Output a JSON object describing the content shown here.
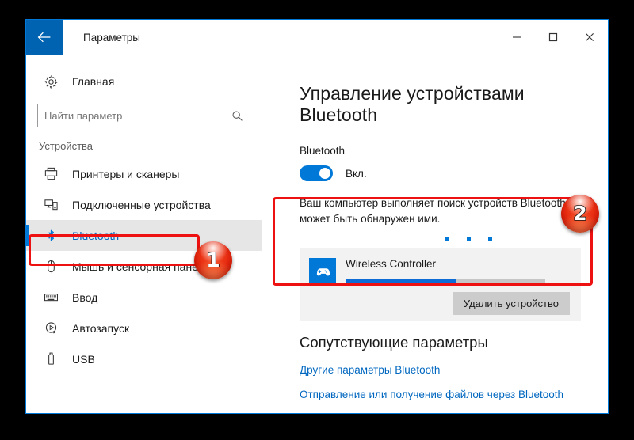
{
  "window": {
    "title": "Параметры",
    "back_icon": "back-arrow-icon",
    "minimize_label": "—",
    "maximize_label": "◻",
    "close_label": "✕"
  },
  "sidebar": {
    "home": {
      "label": "Главная",
      "icon": "gear-icon"
    },
    "search": {
      "placeholder": "Найти параметр",
      "value": "",
      "icon": "search-icon"
    },
    "section_header": "Устройства",
    "items": [
      {
        "label": "Принтеры и сканеры",
        "icon": "printer-icon",
        "selected": false
      },
      {
        "label": "Подключенные устройства",
        "icon": "connected-devices-icon",
        "selected": false
      },
      {
        "label": "Bluetooth",
        "icon": "bluetooth-icon",
        "selected": true
      },
      {
        "label": "Мышь и сенсорная панель",
        "icon": "mouse-icon",
        "selected": false
      },
      {
        "label": "Ввод",
        "icon": "keyboard-icon",
        "selected": false
      },
      {
        "label": "Автозапуск",
        "icon": "autoplay-icon",
        "selected": false
      },
      {
        "label": "USB",
        "icon": "usb-icon",
        "selected": false
      }
    ]
  },
  "main": {
    "page_title": "Управление устройствами Bluetooth",
    "bluetooth_label": "Bluetooth",
    "toggle": {
      "state_label": "Вкл.",
      "on": true
    },
    "status_text": "Ваш компьютер выполняет поиск устройств Bluetooth и может быть обнаружен ими.",
    "searching_dots": 3,
    "device": {
      "name": "Wireless Controller",
      "icon": "gamepad-icon",
      "progress_percent": 55,
      "remove_button": "Удалить устройство"
    },
    "related_title": "Сопутствующие параметры",
    "links": [
      "Другие параметры Bluetooth",
      "Отправление или получение файлов через Bluetooth"
    ]
  },
  "annotations": {
    "badges": [
      {
        "number": "1",
        "target": "sidebar-item-bluetooth"
      },
      {
        "number": "2",
        "target": "device-card"
      }
    ],
    "highlight_color": "#ee1111"
  }
}
